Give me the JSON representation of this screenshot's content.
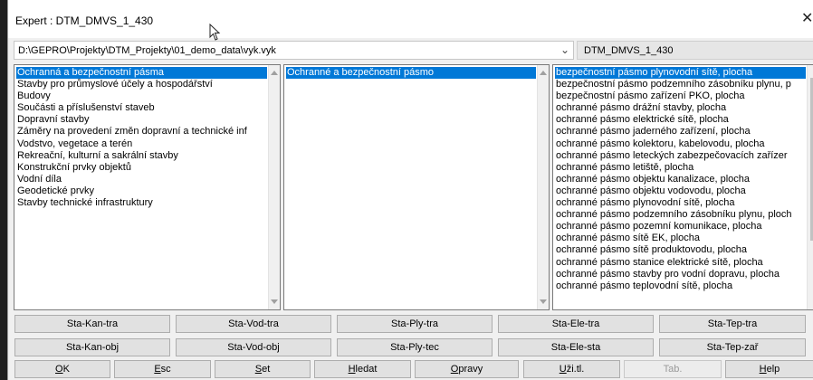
{
  "window": {
    "title": "Expert : DTM_DMVS_1_430"
  },
  "path": {
    "value": "D:\\GEPRO\\Projekty\\DTM_Projekty\\01_demo_data\\vyk.vyk"
  },
  "model": {
    "value": "DTM_DMVS_1_430"
  },
  "list1": {
    "items": [
      "Ochranná a bezpečnostní pásma",
      "Stavby pro průmyslové účely a hospodářství",
      "Budovy",
      "Součásti a příslušenství staveb",
      "Dopravní stavby",
      "Záměry na provedení změn dopravní a technické inf",
      "Vodstvo, vegetace a terén",
      "Rekreační, kulturní a sakrální stavby",
      "Konstrukční prvky objektů",
      "Vodní díla",
      "Geodetické prvky",
      "Stavby technické infrastruktury"
    ]
  },
  "list2": {
    "items": [
      "Ochranné a bezpečnostní pásmo"
    ]
  },
  "list3": {
    "items": [
      "bezpečnostní pásmo plynovodní sítě, plocha",
      "bezpečnostní pásmo podzemního zásobníku plynu, p",
      "bezpečnostní pásmo zařízení PKO, plocha",
      "ochranné pásmo drážní stavby, plocha",
      "ochranné pásmo elektrické sítě, plocha",
      "ochranné pásmo jaderného zařízení, plocha",
      "ochranné pásmo kolektoru, kabelovodu, plocha",
      "ochranné pásmo leteckých zabezpečovacích zařízer",
      "ochranné pásmo letiště, plocha",
      "ochranné pásmo objektu kanalizace, plocha",
      "ochranné pásmo objektu vodovodu, plocha",
      "ochranné pásmo plynovodní sítě, plocha",
      "ochranné pásmo podzemního zásobníku plynu, ploch",
      "ochranné pásmo pozemní komunikace, plocha",
      "ochranné pásmo sítě EK, plocha",
      "ochranné pásmo sítě produktovodu, plocha",
      "ochranné pásmo stanice elektrické sítě, plocha",
      "ochranné pásmo stavby pro vodní dopravu, plocha",
      "ochranné pásmo teplovodní sítě, plocha"
    ]
  },
  "row1": [
    "Sta-Kan-tra",
    "Sta-Vod-tra",
    "Sta-Ply-tra",
    "Sta-Ele-tra",
    "Sta-Tep-tra"
  ],
  "row2": [
    "Sta-Kan-obj",
    "Sta-Vod-obj",
    "Sta-Ply-tec",
    "Sta-Ele-sta",
    "Sta-Tep-zař"
  ],
  "row3": [
    "OK",
    "Esc",
    "Set",
    "Hledat",
    "Opravy",
    "Uži.tl.",
    "Tab.",
    "Help"
  ],
  "colors": {
    "selection": "#0078d7"
  }
}
